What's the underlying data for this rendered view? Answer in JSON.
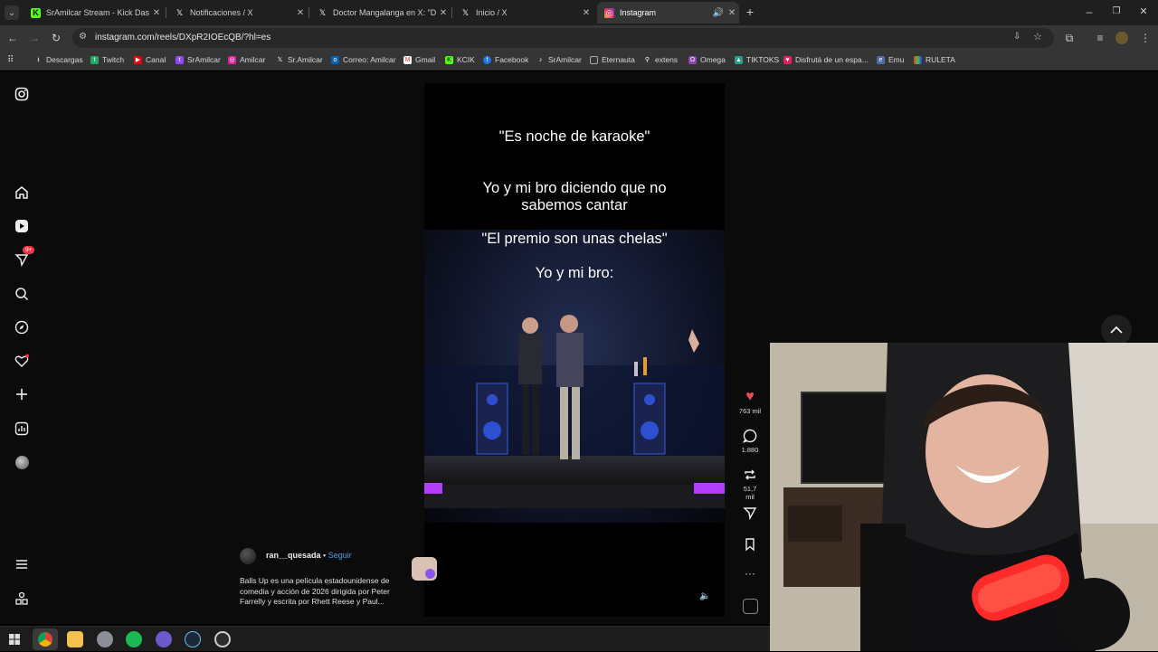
{
  "browser": {
    "tabs": [
      {
        "title": "SrAmilcar Stream - Kick Dashbo",
        "icon": "kick-icon"
      },
      {
        "title": "Notificaciones / X",
        "icon": "x-icon"
      },
      {
        "title": "Doctor Mangalanga en X: \"Disc",
        "icon": "x-icon"
      },
      {
        "title": "Inicio / X",
        "icon": "x-icon"
      },
      {
        "title": "Instagram",
        "icon": "instagram-icon"
      }
    ],
    "url": "instagram.com/reels/DXpR2IOEcQB/?hl=es",
    "bookmarks": [
      "Descargas",
      "Twitch",
      "Canal",
      "SrAmilcar",
      "Amilcar",
      "Sr.Amilcar",
      "Correo: Amilcar",
      "Gmail",
      "KCIK",
      "Facebook",
      "SrAmilcar",
      "Eternauta",
      "extens",
      "Omega",
      "TIKTOKS",
      "Disfrutá de un espa...",
      "Emu",
      "RULETA"
    ]
  },
  "sidebar": {
    "notification_badge": "9+"
  },
  "reel": {
    "captions": [
      "\"Es noche de karaoke\"",
      "Yo y mi bro diciendo que no sabemos cantar",
      "\"El premio son unas chelas\"",
      "Yo y mi bro:"
    ],
    "author": "ran__quesada",
    "follow_label": "Seguir",
    "description": "Balls Up es una película estadounidense de comedia y acción de 2026 dirigida por Peter Farrelly y escrita por Rhett Reese y Paul..."
  },
  "actions": {
    "likes": "763 mil",
    "comments": "1.880",
    "reposts": "51,7 mil"
  },
  "colors": {
    "like": "#ed4956",
    "follow": "#4c9cf5",
    "active_tab": "#353535"
  }
}
